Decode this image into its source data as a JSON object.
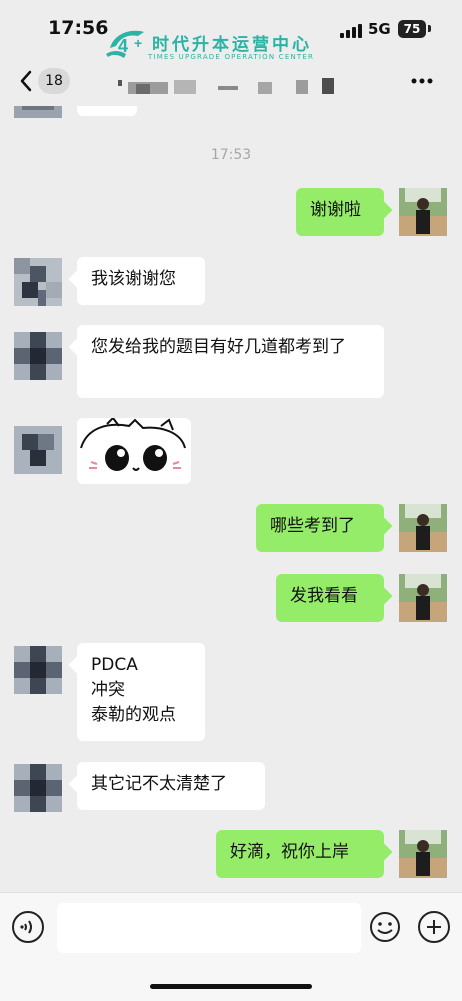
{
  "status_bar": {
    "time": "17:56",
    "network": "5G",
    "battery": "75"
  },
  "watermark": {
    "title": "时代升本运营中心",
    "subtitle": "TIMES UPGRADE OPERATION CENTER"
  },
  "nav": {
    "unread_count": "18",
    "more_icon": "ellipsis-icon",
    "back_icon": "chevron-left-icon"
  },
  "chat": {
    "top_timestamp": "17:53",
    "messages": [
      {
        "side": "out",
        "text": "谢谢啦"
      },
      {
        "side": "in",
        "text": "我该谢谢您"
      },
      {
        "side": "in",
        "text": "您发给我的题目有好几道都考到了"
      },
      {
        "side": "in",
        "type": "sticker",
        "sticker": "cat-sticker"
      },
      {
        "side": "out",
        "text": "哪些考到了"
      },
      {
        "side": "out",
        "text": "发我看看"
      },
      {
        "side": "in",
        "text": "PDCA\n冲突\n泰勒的观点"
      },
      {
        "side": "in",
        "text": "其它记不太清楚了"
      },
      {
        "side": "out",
        "text": "好滴，祝你上岸"
      }
    ]
  },
  "input_bar": {
    "voice_icon": "voice-icon",
    "emoji_icon": "emoji-icon",
    "plus_icon": "plus-icon",
    "text_value": ""
  },
  "colors": {
    "background": "#ededed",
    "outgoing_bubble": "#95ec69",
    "incoming_bubble": "#ffffff",
    "watermark": "#2bb3a6"
  }
}
